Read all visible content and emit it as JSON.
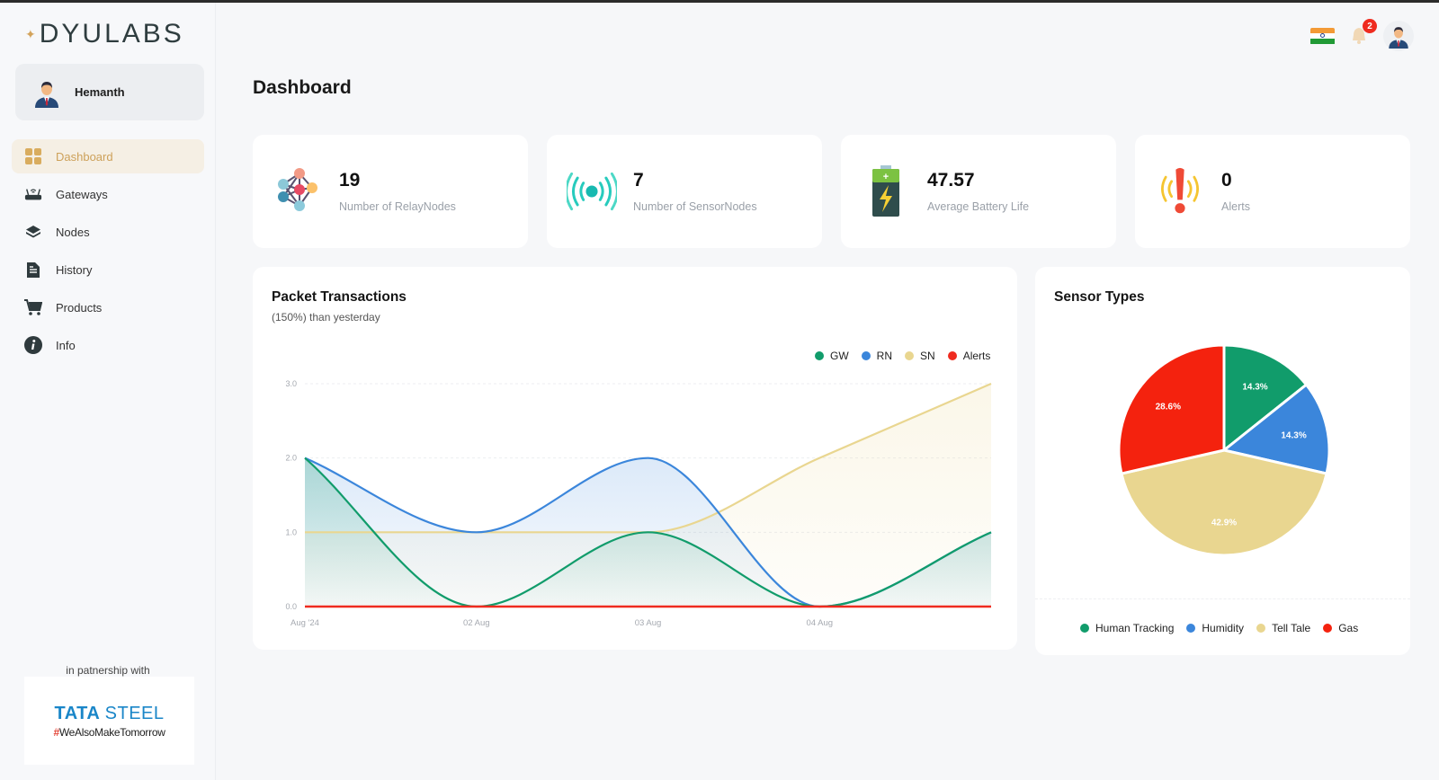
{
  "app": {
    "logo_text": "DYULABS",
    "logo_spark": "✦"
  },
  "user": {
    "name": "Hemanth",
    "avatar_icon": "user-avatar-icon"
  },
  "sidebar": {
    "items": [
      {
        "label": "Dashboard",
        "icon": "grid-icon",
        "active": true
      },
      {
        "label": "Gateways",
        "icon": "router-icon",
        "active": false
      },
      {
        "label": "Nodes",
        "icon": "layers-icon",
        "active": false
      },
      {
        "label": "History",
        "icon": "document-icon",
        "active": false
      },
      {
        "label": "Products",
        "icon": "cart-icon",
        "active": false
      },
      {
        "label": "Info",
        "icon": "info-icon",
        "active": false
      }
    ],
    "partner_text": "in patnership with",
    "partner_brand": "TATA",
    "partner_brand2": "STEEL",
    "partner_tag_hash": "#",
    "partner_tag": "WeAlsoMakeTomorrow"
  },
  "topbar": {
    "flag_icon": "india-flag-icon",
    "notification_count": "2",
    "profile_icon": "user-avatar-icon"
  },
  "page": {
    "title": "Dashboard"
  },
  "stats": [
    {
      "value": "19",
      "label": "Number of RelayNodes",
      "icon": "network-icon"
    },
    {
      "value": "7",
      "label": "Number of SensorNodes",
      "icon": "signal-icon"
    },
    {
      "value": "47.57",
      "label": "Average Battery Life",
      "icon": "battery-icon"
    },
    {
      "value": "0",
      "label": "Alerts",
      "icon": "alert-icon"
    }
  ],
  "colors": {
    "gw": "#119c6b",
    "rn": "#3b86db",
    "sn": "#e9d690",
    "alerts": "#ef2b1f",
    "accent": "#cda15a"
  },
  "packet_card": {
    "title": "Packet Transactions",
    "subtitle": "(150%) than yesterday"
  },
  "sensor_card": {
    "title": "Sensor Types"
  },
  "chart_data": [
    {
      "type": "area",
      "title": "Packet Transactions",
      "subtitle": "(150%) than yesterday",
      "x": [
        "Aug '24",
        "02 Aug",
        "03 Aug",
        "04 Aug",
        ""
      ],
      "series": [
        {
          "name": "GW",
          "values": [
            2,
            0,
            1,
            0,
            1
          ],
          "color": "#119c6b"
        },
        {
          "name": "RN",
          "values": [
            2,
            1,
            2,
            0,
            1
          ],
          "color": "#3b86db"
        },
        {
          "name": "SN",
          "values": [
            1,
            1,
            1,
            2,
            3
          ],
          "color": "#e9d690"
        },
        {
          "name": "Alerts",
          "values": [
            0,
            0,
            0,
            0,
            0
          ],
          "color": "#ef2b1f"
        }
      ],
      "yticks": [
        "0.0",
        "1.0",
        "2.0",
        "3.0"
      ],
      "ylim": [
        0,
        3
      ],
      "xlabel": "",
      "ylabel": "",
      "grid": true,
      "legend": "top-right"
    },
    {
      "type": "pie",
      "title": "Sensor Types",
      "slices": [
        {
          "label": "Human Tracking",
          "value": 14.3,
          "display": "14.3%",
          "color": "#119c6b"
        },
        {
          "label": "Humidity",
          "value": 14.3,
          "display": "14.3%",
          "color": "#3b86db"
        },
        {
          "label": "Tell Tale",
          "value": 42.9,
          "display": "42.9%",
          "color": "#e9d690"
        },
        {
          "label": "Gas",
          "value": 28.6,
          "display": "28.6%",
          "color": "#f4220e"
        }
      ],
      "legend": "bottom"
    }
  ]
}
